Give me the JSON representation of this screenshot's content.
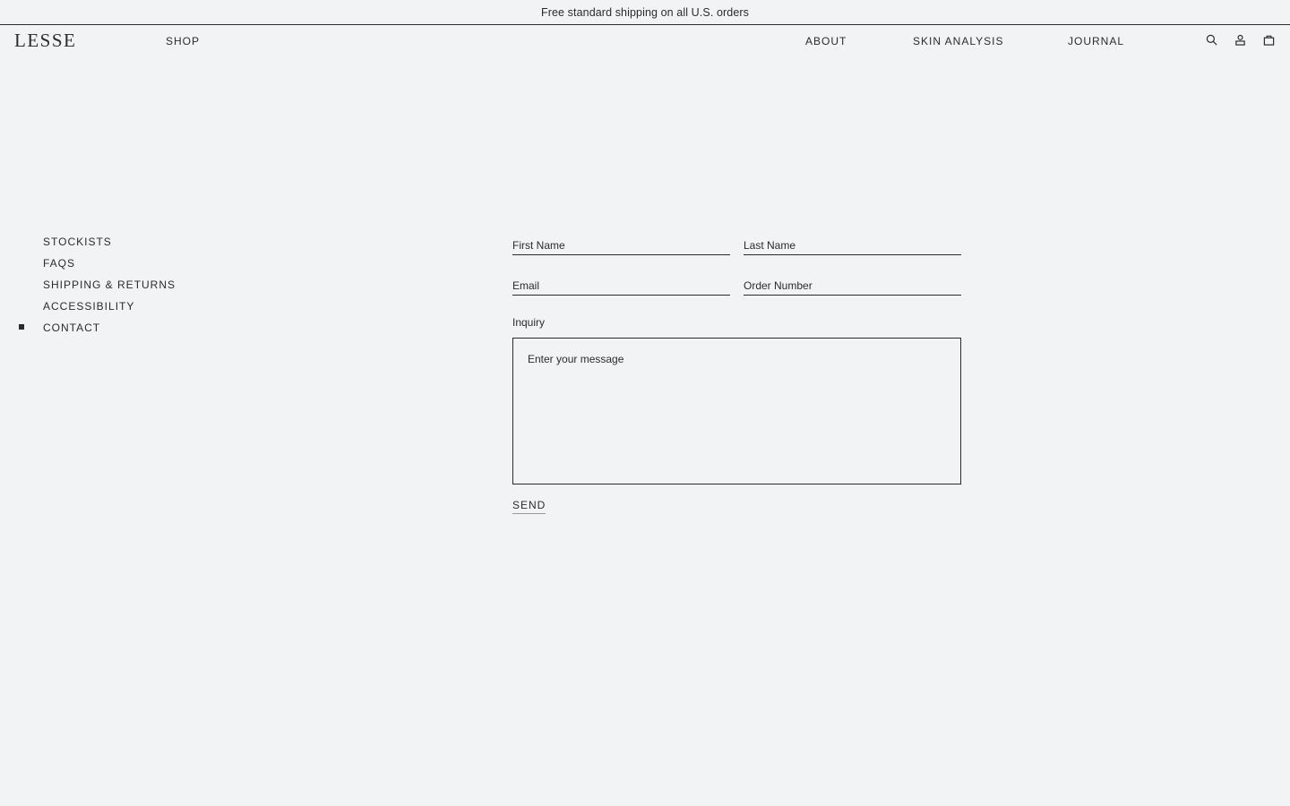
{
  "announcement": "Free standard shipping on all U.S. orders",
  "header": {
    "logo": "LESSE",
    "nav": {
      "shop": "SHOP",
      "about": "ABOUT",
      "skin_analysis": "SKIN ANALYSIS",
      "journal": "JOURNAL"
    },
    "icons": [
      "search-icon",
      "account-icon",
      "bag-icon"
    ]
  },
  "sidebar": {
    "items": [
      {
        "label": "STOCKISTS",
        "active": false
      },
      {
        "label": "FAQS",
        "active": false
      },
      {
        "label": "SHIPPING & RETURNS",
        "active": false
      },
      {
        "label": "ACCESSIBILITY",
        "active": false
      },
      {
        "label": "CONTACT",
        "active": true
      }
    ]
  },
  "form": {
    "first_name": {
      "placeholder": "First Name",
      "value": ""
    },
    "last_name": {
      "placeholder": "Last Name",
      "value": ""
    },
    "email": {
      "placeholder": "Email",
      "value": ""
    },
    "order_number": {
      "placeholder": "Order Number",
      "value": ""
    },
    "inquiry_label": "Inquiry",
    "message": {
      "placeholder": "Enter your message",
      "value": ""
    },
    "send_label": "SEND"
  },
  "colors": {
    "background": "#f2f3f5",
    "text": "#2b2b2b"
  }
}
